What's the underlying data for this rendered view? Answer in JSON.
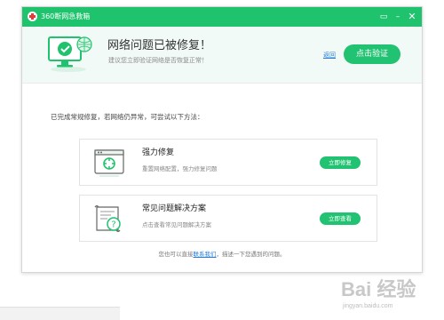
{
  "window": {
    "title": "360断网急救箱",
    "controls": {
      "feedback": "▭",
      "minimize": "–",
      "close": "✕"
    }
  },
  "header": {
    "title": "网络问题已被修复！",
    "subtitle": "建议您立即验证网络是否恢复正常！",
    "back_link": "返回",
    "verify_button": "点击验证"
  },
  "hint": "已完成常规修复，若网络仍异常，可尝试以下方法：",
  "cards": [
    {
      "title": "强力修复",
      "desc": "重置网络配置，强力修复问题",
      "button": "立即修复",
      "icon": "repair-icon"
    },
    {
      "title": "常见问题解决方案",
      "desc": "点击查看常见问题解决方案",
      "button": "立即查看",
      "icon": "faq-document-icon"
    }
  ],
  "footer": {
    "prefix": "您也可以直接",
    "link": "联系我们",
    "suffix": "，描述一下您遇到的问题。"
  },
  "watermark": {
    "text": "Bai 经验",
    "sub": "jingyan.baidu.com"
  },
  "colors": {
    "brand": "#1fc36d",
    "button": "#21c271",
    "link": "#2a7ed8",
    "header_bg": "#f1faf6"
  }
}
